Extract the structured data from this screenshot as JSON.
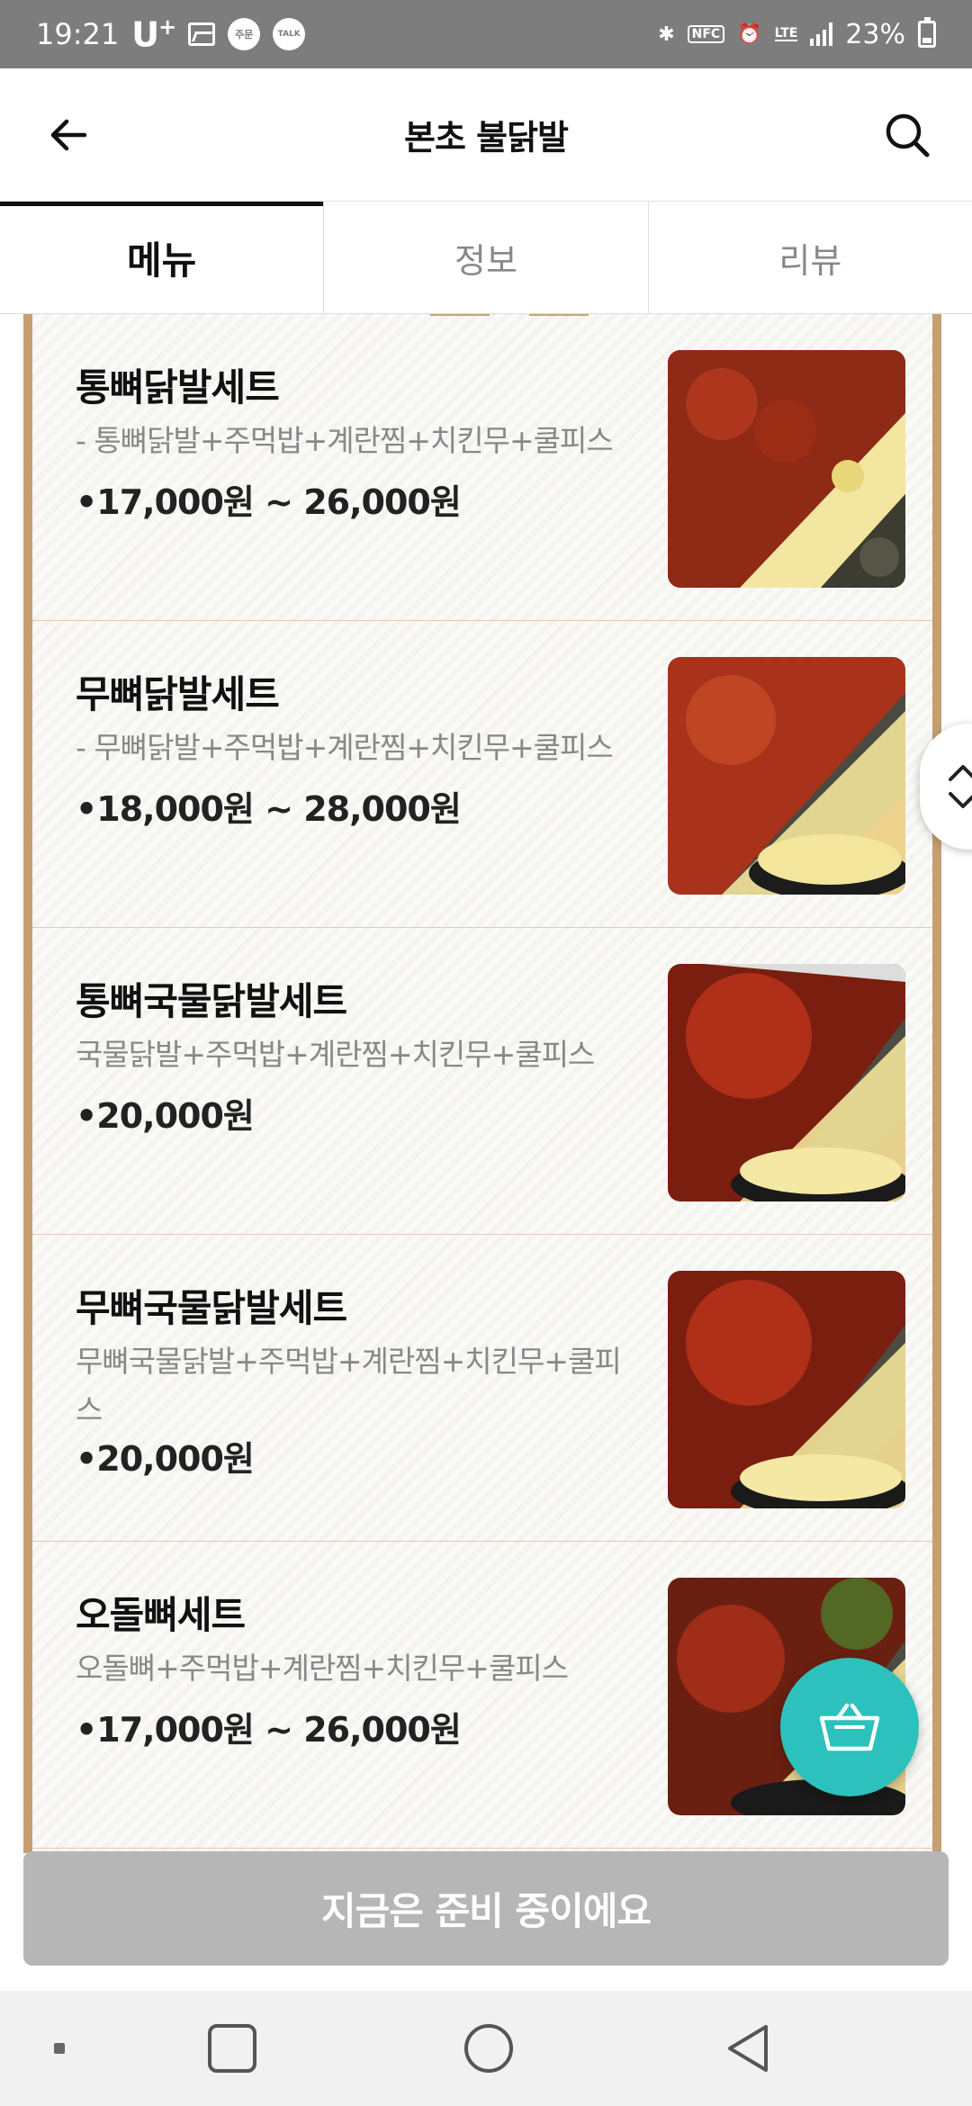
{
  "status_bar": {
    "time": "19:21",
    "carrier": "U",
    "carrier_sup": "+",
    "notif_order": "주문",
    "notif_talk": "TALK",
    "nfc": "NFC",
    "lte": "LTE",
    "battery": "23%"
  },
  "header": {
    "title": "본초 불닭발"
  },
  "tabs": [
    {
      "label": "메뉴"
    },
    {
      "label": "정보"
    },
    {
      "label": "리뷰"
    }
  ],
  "menu_items": [
    {
      "name": "통뼈닭발세트",
      "desc": "- 통뼈닭발+주먹밥+계란찜+치킨무+쿨피스",
      "price": "17,000원 ~ 26,000원"
    },
    {
      "name": "무뼈닭발세트",
      "desc": "- 무뼈닭발+주먹밥+계란찜+치킨무+쿨피스",
      "price": "18,000원 ~ 28,000원"
    },
    {
      "name": "통뼈국물닭발세트",
      "desc": "국물닭발+주먹밥+계란찜+치킨무+쿨피스",
      "price": "20,000원"
    },
    {
      "name": "무뼈국물닭발세트",
      "desc": "무뼈국물닭발+주먹밥+계란찜+치킨무+쿨피스",
      "price": "20,000원"
    },
    {
      "name": "오돌뼈세트",
      "desc": "오돌뼈+주먹밥+계란찜+치킨무+쿨피스",
      "price": "17,000원 ~ 26,000원"
    }
  ],
  "order_bar": {
    "label": "지금은 준비 중이에요"
  },
  "price_bullet": "•",
  "colors": {
    "status_bar": "#7d7d7d",
    "board_border": "#c59f72",
    "cart_fab": "#2cc1bd",
    "order_bar_disabled": "#b6b6b6"
  },
  "icons": {
    "back": "arrow-left-icon",
    "search": "search-icon",
    "scroll": "chevron-up-down-icon",
    "cart": "basket-icon"
  }
}
